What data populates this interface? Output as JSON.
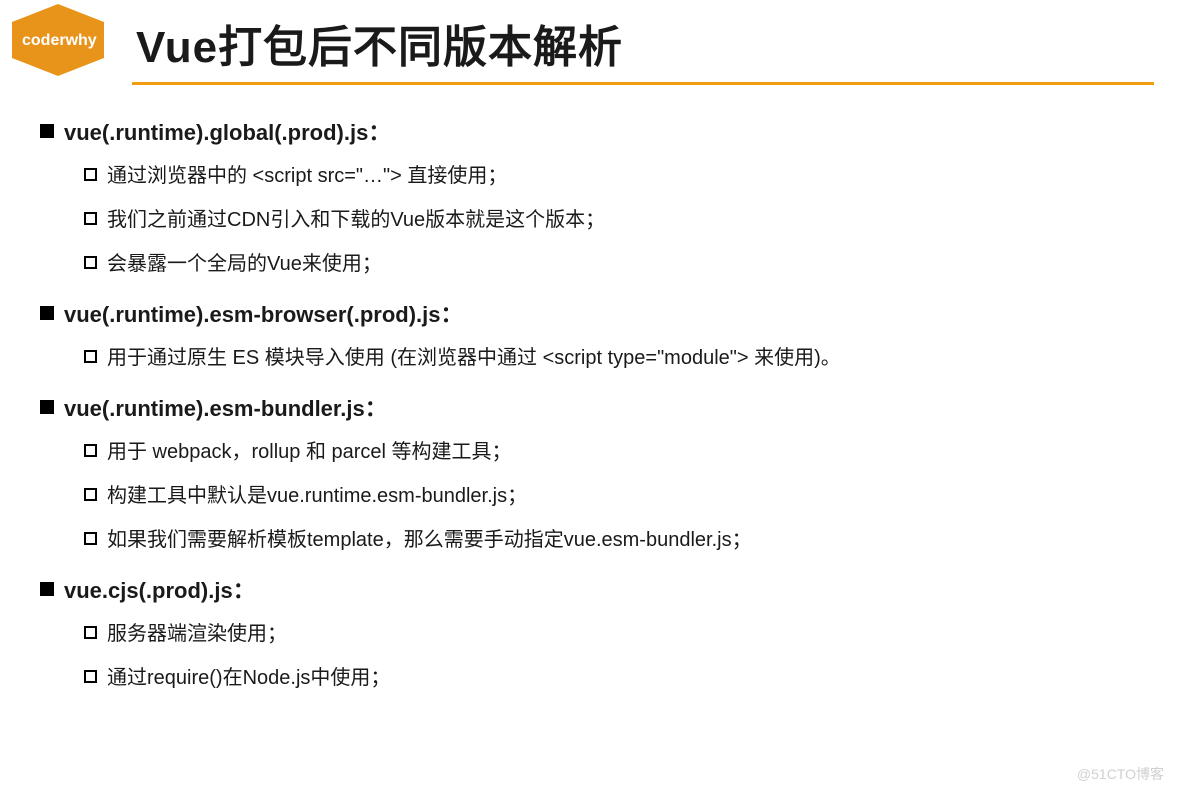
{
  "badge_label": "coderwhy",
  "title": "Vue打包后不同版本解析",
  "sections": [
    {
      "heading": "vue(.runtime).global(.prod).js：",
      "items": [
        "通过浏览器中的 <script src=\"…\"> 直接使用；",
        "我们之前通过CDN引入和下载的Vue版本就是这个版本；",
        "会暴露一个全局的Vue来使用；"
      ]
    },
    {
      "heading": "vue(.runtime).esm-browser(.prod).js：",
      "items": [
        "用于通过原生 ES 模块导入使用 (在浏览器中通过 <script type=\"module\"> 来使用)。"
      ]
    },
    {
      "heading": "vue(.runtime).esm-bundler.js：",
      "items": [
        "用于 webpack，rollup 和 parcel 等构建工具；",
        "构建工具中默认是vue.runtime.esm-bundler.js；",
        "如果我们需要解析模板template，那么需要手动指定vue.esm-bundler.js；"
      ]
    },
    {
      "heading": "vue.cjs(.prod).js：",
      "items": [
        "服务器端渲染使用；",
        "通过require()在Node.js中使用；"
      ]
    }
  ],
  "watermark": "@51CTO博客"
}
